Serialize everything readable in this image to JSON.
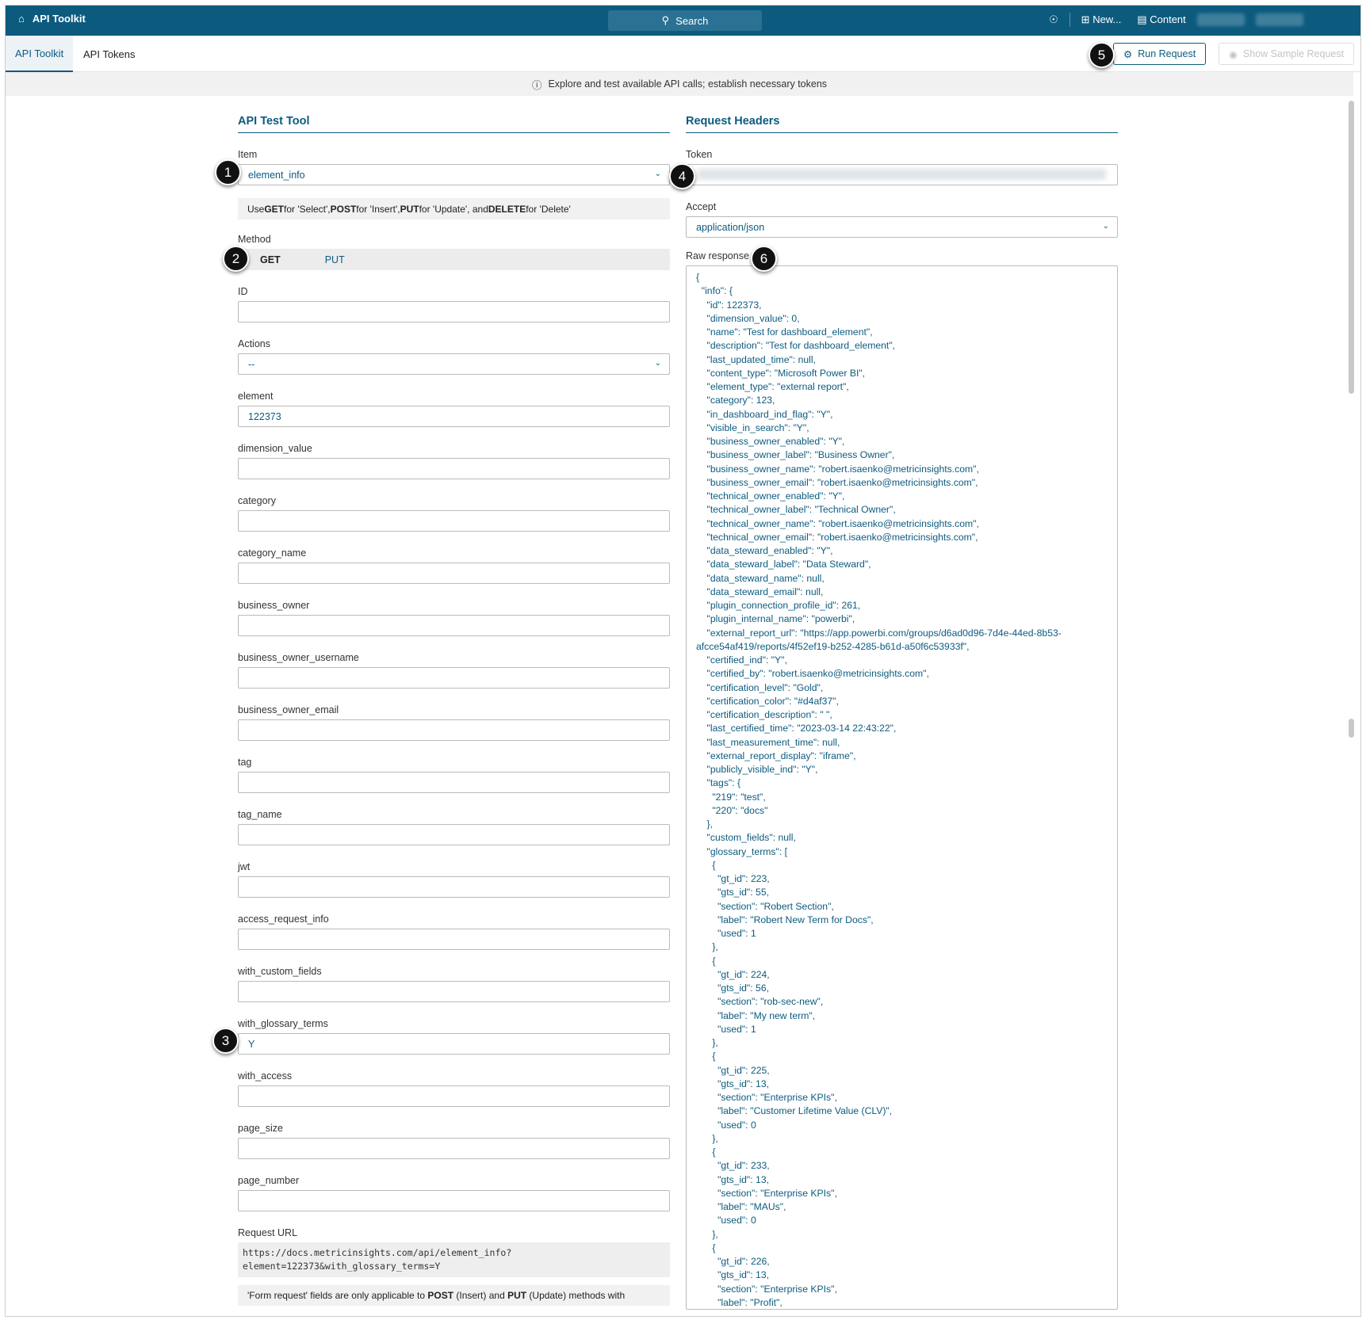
{
  "topbar": {
    "title": "API Toolkit",
    "search": "Search",
    "new": "New...",
    "content": "Content"
  },
  "tabs": [
    "API Toolkit",
    "API Tokens"
  ],
  "buttons": {
    "run": "Run Request",
    "sample": "Show Sample Request"
  },
  "info": "Explore and test available API calls; establish necessary tokens",
  "left": {
    "heading": "API Test Tool",
    "item_label": "Item",
    "item_value": "element_info",
    "hint": [
      "Use ",
      "GET",
      " for 'Select', ",
      "POST",
      " for 'Insert', ",
      "PUT",
      " for 'Update', and ",
      "DELETE",
      " for 'Delete'"
    ],
    "method_label": "Method",
    "methods": [
      "GET",
      "PUT"
    ],
    "fields": [
      {
        "label": "ID",
        "value": ""
      },
      {
        "label": "Actions",
        "value": "--",
        "select": true
      },
      {
        "label": "element",
        "value": "122373"
      },
      {
        "label": "dimension_value",
        "value": ""
      },
      {
        "label": "category",
        "value": ""
      },
      {
        "label": "category_name",
        "value": ""
      },
      {
        "label": "business_owner",
        "value": ""
      },
      {
        "label": "business_owner_username",
        "value": ""
      },
      {
        "label": "business_owner_email",
        "value": ""
      },
      {
        "label": "tag",
        "value": ""
      },
      {
        "label": "tag_name",
        "value": ""
      },
      {
        "label": "jwt",
        "value": ""
      },
      {
        "label": "access_request_info",
        "value": ""
      },
      {
        "label": "with_custom_fields",
        "value": ""
      },
      {
        "label": "with_glossary_terms",
        "value": "Y"
      },
      {
        "label": "with_access",
        "value": ""
      },
      {
        "label": "page_size",
        "value": ""
      },
      {
        "label": "page_number",
        "value": ""
      }
    ],
    "url_label": "Request URL",
    "url": [
      "https://docs.metricinsights.com/api/element_info?",
      "element=122373&with_glossary_terms=Y"
    ],
    "note": [
      "'Form request' fields are only applicable to ",
      "POST",
      " (Insert) and ",
      "PUT",
      " (Update) methods with"
    ]
  },
  "right": {
    "heading": "Request Headers",
    "token_label": "Token",
    "accept_label": "Accept",
    "accept_value": "application/json",
    "raw_label": "Raw response",
    "raw_lines": [
      "{",
      "  \"info\": {",
      "    \"id\": 122373,",
      "    \"dimension_value\": 0,",
      "    \"name\": \"Test for dashboard_element\",",
      "    \"description\": \"Test for dashboard_element\",",
      "    \"last_updated_time\": null,",
      "    \"content_type\": \"Microsoft Power BI\",",
      "    \"element_type\": \"external report\",",
      "    \"category\": 123,",
      "    \"in_dashboard_ind_flag\": \"Y\",",
      "    \"visible_in_search\": \"Y\",",
      "    \"business_owner_enabled\": \"Y\",",
      "    \"business_owner_label\": \"Business Owner\",",
      "    \"business_owner_name\": \"robert.isaenko@metricinsights.com\",",
      "    \"business_owner_email\": \"robert.isaenko@metricinsights.com\",",
      "    \"technical_owner_enabled\": \"Y\",",
      "    \"technical_owner_label\": \"Technical Owner\",",
      "    \"technical_owner_name\": \"robert.isaenko@metricinsights.com\",",
      "    \"technical_owner_email\": \"robert.isaenko@metricinsights.com\",",
      "    \"data_steward_enabled\": \"Y\",",
      "    \"data_steward_label\": \"Data Steward\",",
      "    \"data_steward_name\": null,",
      "    \"data_steward_email\": null,",
      "    \"plugin_connection_profile_id\": 261,",
      "    \"plugin_internal_name\": \"powerbi\",",
      "    \"external_report_url\": \"https://app.powerbi.com/groups/d6ad0d96-7d4e-44ed-8b53-",
      "afcce54af419/reports/4f52ef19-b252-4285-b61d-a50f6c53933f\",",
      "    \"certified_ind\": \"Y\",",
      "    \"certified_by\": \"robert.isaenko@metricinsights.com\",",
      "    \"certification_level\": \"Gold\",",
      "    \"certification_color\": \"#d4af37\",",
      "    \"certification_description\": \" \",",
      "    \"last_certified_time\": \"2023-03-14 22:43:22\",",
      "    \"last_measurement_time\": null,",
      "    \"external_report_display\": \"iframe\",",
      "    \"publicly_visible_ind\": \"Y\",",
      "    \"tags\": {",
      "      \"219\": \"test\",",
      "      \"220\": \"docs\"",
      "    },",
      "    \"custom_fields\": null,",
      "    \"glossary_terms\": [",
      "      {",
      "        \"gt_id\": 223,",
      "        \"gts_id\": 55,",
      "        \"section\": \"Robert Section\",",
      "        \"label\": \"Robert New Term for Docs\",",
      "        \"used\": 1",
      "      },",
      "      {",
      "        \"gt_id\": 224,",
      "        \"gts_id\": 56,",
      "        \"section\": \"rob-sec-new\",",
      "        \"label\": \"My new term\",",
      "        \"used\": 1",
      "      },",
      "      {",
      "        \"gt_id\": 225,",
      "        \"gts_id\": 13,",
      "        \"section\": \"Enterprise KPIs\",",
      "        \"label\": \"Customer Lifetime Value (CLV)\",",
      "        \"used\": 0",
      "      },",
      "      {",
      "        \"gt_id\": 233,",
      "        \"gts_id\": 13,",
      "        \"section\": \"Enterprise KPIs\",",
      "        \"label\": \"MAUs\",",
      "        \"used\": 0",
      "      },",
      "      {",
      "        \"gt_id\": 226,",
      "        \"gts_id\": 13,",
      "        \"section\": \"Enterprise KPIs\",",
      "        \"label\": \"Profit\","
    ]
  },
  "callouts": [
    "1",
    "2",
    "3",
    "4",
    "5",
    "6"
  ]
}
